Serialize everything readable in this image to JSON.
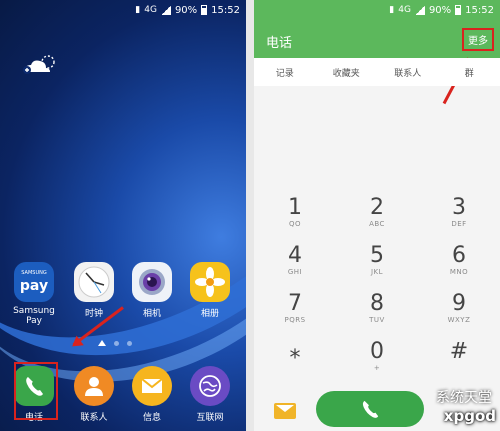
{
  "left": {
    "status": {
      "signal": "4G",
      "battery": "90%",
      "time": "15:52"
    },
    "apps_row": [
      {
        "label": "Samsung Pay",
        "icon": "samsung-pay-icon",
        "text": "SAMSUNG",
        "sub": "pay"
      },
      {
        "label": "时钟",
        "icon": "clock-icon"
      },
      {
        "label": "相机",
        "icon": "camera-icon"
      },
      {
        "label": "相册",
        "icon": "gallery-icon"
      }
    ],
    "dock": [
      {
        "label": "电话",
        "icon": "phone-icon"
      },
      {
        "label": "联系人",
        "icon": "contacts-icon"
      },
      {
        "label": "信息",
        "icon": "messages-icon"
      },
      {
        "label": "互联网",
        "icon": "internet-icon"
      }
    ]
  },
  "right": {
    "status": {
      "signal": "4G",
      "battery": "90%",
      "time": "15:52"
    },
    "title": "电话",
    "more": "更多",
    "tabs": [
      "记录",
      "收藏夹",
      "联系人",
      "群"
    ],
    "keys": [
      {
        "d": "1",
        "l": "QO"
      },
      {
        "d": "2",
        "l": "ABC"
      },
      {
        "d": "3",
        "l": "DEF"
      },
      {
        "d": "4",
        "l": "GHI"
      },
      {
        "d": "5",
        "l": "JKL"
      },
      {
        "d": "6",
        "l": "MNO"
      },
      {
        "d": "7",
        "l": "PQRS"
      },
      {
        "d": "8",
        "l": "TUV"
      },
      {
        "d": "9",
        "l": "WXYZ"
      },
      {
        "d": "⁎",
        "l": ""
      },
      {
        "d": "0",
        "l": "+"
      },
      {
        "d": "#",
        "l": ""
      }
    ],
    "watermark_cn": "系统天堂",
    "watermark_en": "xpgod"
  },
  "colors": {
    "green": "#5cb85c",
    "highlight": "#d9231e"
  }
}
